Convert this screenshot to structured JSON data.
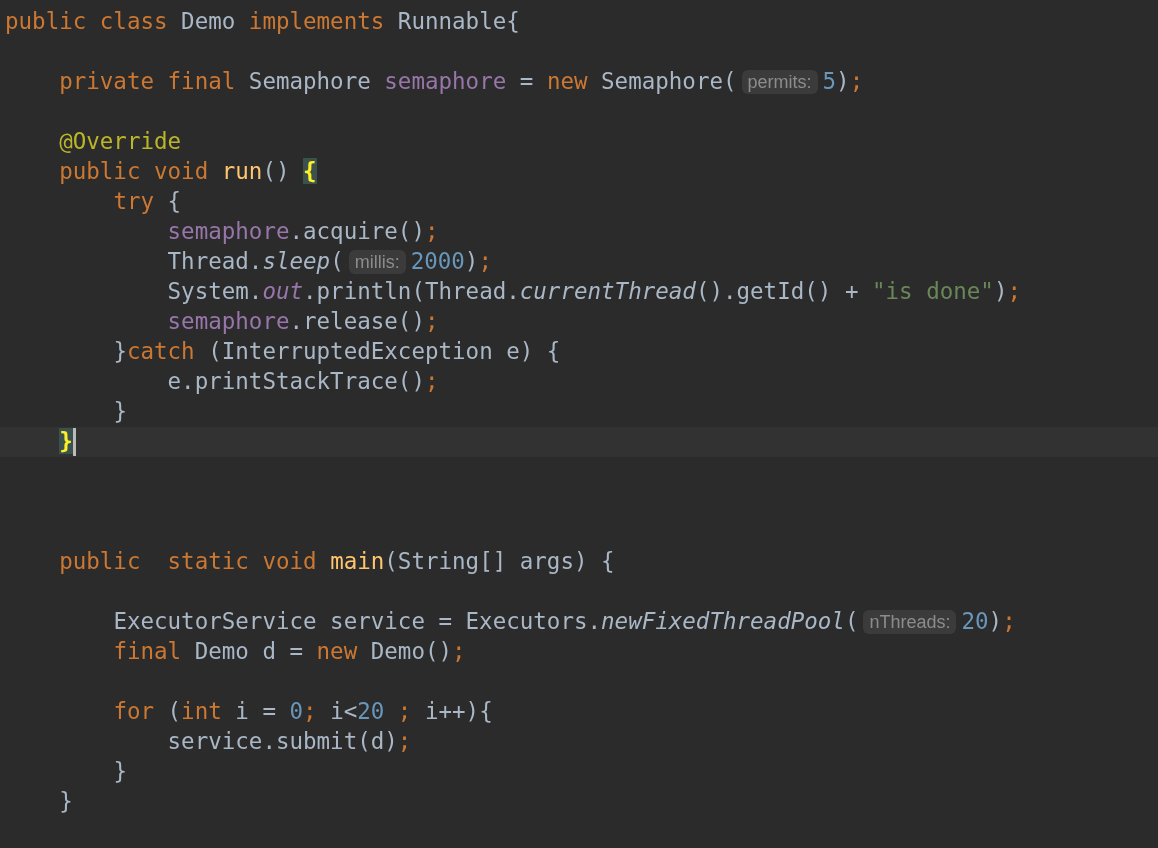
{
  "editor": {
    "lines": [
      {
        "kind": "code",
        "tokens": [
          {
            "kind": "keyword",
            "text": "public class "
          },
          {
            "kind": "plain",
            "text": "Demo "
          },
          {
            "kind": "keyword",
            "text": "implements "
          },
          {
            "kind": "plain",
            "text": "Runnable{"
          }
        ]
      },
      {
        "kind": "blank"
      },
      {
        "kind": "code",
        "tokens": [
          {
            "kind": "keyword",
            "text": "    private final "
          },
          {
            "kind": "plain",
            "text": "Semaphore "
          },
          {
            "kind": "field",
            "text": "semaphore"
          },
          {
            "kind": "plain",
            "text": " = "
          },
          {
            "kind": "keyword",
            "text": "new "
          },
          {
            "kind": "plain",
            "text": "Semaphore("
          },
          {
            "kind": "hint",
            "text": "permits:"
          },
          {
            "kind": "number",
            "text": "5"
          },
          {
            "kind": "plain",
            "text": ")"
          },
          {
            "kind": "keyword",
            "text": ";"
          }
        ]
      },
      {
        "kind": "blank"
      },
      {
        "kind": "code",
        "tokens": [
          {
            "kind": "annotation",
            "text": "    @Override"
          }
        ]
      },
      {
        "kind": "code",
        "tokens": [
          {
            "kind": "keyword",
            "text": "    public void "
          },
          {
            "kind": "method",
            "text": "run"
          },
          {
            "kind": "plain",
            "text": "() "
          },
          {
            "kind": "brace-match",
            "text": "{"
          }
        ]
      },
      {
        "kind": "code",
        "tokens": [
          {
            "kind": "keyword",
            "text": "        try "
          },
          {
            "kind": "plain",
            "text": "{"
          }
        ]
      },
      {
        "kind": "code",
        "tokens": [
          {
            "kind": "field",
            "text": "            semaphore"
          },
          {
            "kind": "plain",
            "text": ".acquire()"
          },
          {
            "kind": "keyword",
            "text": ";"
          }
        ]
      },
      {
        "kind": "code",
        "tokens": [
          {
            "kind": "plain",
            "text": "            Thread."
          },
          {
            "kind": "static-call",
            "text": "sleep"
          },
          {
            "kind": "plain",
            "text": "("
          },
          {
            "kind": "hint",
            "text": "millis:"
          },
          {
            "kind": "number",
            "text": "2000"
          },
          {
            "kind": "plain",
            "text": ")"
          },
          {
            "kind": "keyword",
            "text": ";"
          }
        ]
      },
      {
        "kind": "code",
        "tokens": [
          {
            "kind": "plain",
            "text": "            System."
          },
          {
            "kind": "static-field",
            "text": "out"
          },
          {
            "kind": "plain",
            "text": ".println(Thread."
          },
          {
            "kind": "static-call",
            "text": "currentThread"
          },
          {
            "kind": "plain",
            "text": "().getId() + "
          },
          {
            "kind": "string",
            "text": "\"is done\""
          },
          {
            "kind": "plain",
            "text": ")"
          },
          {
            "kind": "keyword",
            "text": ";"
          }
        ]
      },
      {
        "kind": "code",
        "tokens": [
          {
            "kind": "field",
            "text": "            semaphore"
          },
          {
            "kind": "plain",
            "text": ".release()"
          },
          {
            "kind": "keyword",
            "text": ";"
          }
        ]
      },
      {
        "kind": "code",
        "tokens": [
          {
            "kind": "plain",
            "text": "        }"
          },
          {
            "kind": "keyword",
            "text": "catch "
          },
          {
            "kind": "plain",
            "text": "(InterruptedException e) {"
          }
        ]
      },
      {
        "kind": "code",
        "tokens": [
          {
            "kind": "plain",
            "text": "            e.printStackTrace()"
          },
          {
            "kind": "keyword",
            "text": ";"
          }
        ]
      },
      {
        "kind": "code",
        "tokens": [
          {
            "kind": "plain",
            "text": "        }"
          }
        ]
      },
      {
        "kind": "code",
        "current": true,
        "caret": true,
        "tokens": [
          {
            "kind": "brace-match",
            "text": "    }"
          }
        ]
      },
      {
        "kind": "blank"
      },
      {
        "kind": "blank"
      },
      {
        "kind": "blank"
      },
      {
        "kind": "code",
        "tokens": [
          {
            "kind": "keyword",
            "text": "    public  static void "
          },
          {
            "kind": "method",
            "text": "main"
          },
          {
            "kind": "plain",
            "text": "(String[] args) {"
          }
        ]
      },
      {
        "kind": "blank"
      },
      {
        "kind": "code",
        "tokens": [
          {
            "kind": "plain",
            "text": "        ExecutorService service = Executors."
          },
          {
            "kind": "static-call",
            "text": "newFixedThreadPool"
          },
          {
            "kind": "plain",
            "text": "("
          },
          {
            "kind": "hint",
            "text": "nThreads:"
          },
          {
            "kind": "number",
            "text": "20"
          },
          {
            "kind": "plain",
            "text": ")"
          },
          {
            "kind": "keyword",
            "text": ";"
          }
        ]
      },
      {
        "kind": "code",
        "tokens": [
          {
            "kind": "keyword",
            "text": "        final "
          },
          {
            "kind": "plain",
            "text": "Demo d = "
          },
          {
            "kind": "keyword",
            "text": "new "
          },
          {
            "kind": "plain",
            "text": "Demo()"
          },
          {
            "kind": "keyword",
            "text": ";"
          }
        ]
      },
      {
        "kind": "blank"
      },
      {
        "kind": "code",
        "tokens": [
          {
            "kind": "keyword",
            "text": "        for "
          },
          {
            "kind": "plain",
            "text": "("
          },
          {
            "kind": "keyword",
            "text": "int "
          },
          {
            "kind": "plain",
            "text": "i = "
          },
          {
            "kind": "number",
            "text": "0"
          },
          {
            "kind": "keyword",
            "text": "; "
          },
          {
            "kind": "plain",
            "text": "i<"
          },
          {
            "kind": "number",
            "text": "20 "
          },
          {
            "kind": "keyword",
            "text": "; "
          },
          {
            "kind": "plain",
            "text": "i++){"
          }
        ]
      },
      {
        "kind": "code",
        "tokens": [
          {
            "kind": "plain",
            "text": "            service.submit(d)"
          },
          {
            "kind": "keyword",
            "text": ";"
          }
        ]
      },
      {
        "kind": "code",
        "tokens": [
          {
            "kind": "plain",
            "text": "        }"
          }
        ]
      },
      {
        "kind": "code",
        "tokens": [
          {
            "kind": "plain",
            "text": "    }"
          }
        ]
      }
    ]
  }
}
